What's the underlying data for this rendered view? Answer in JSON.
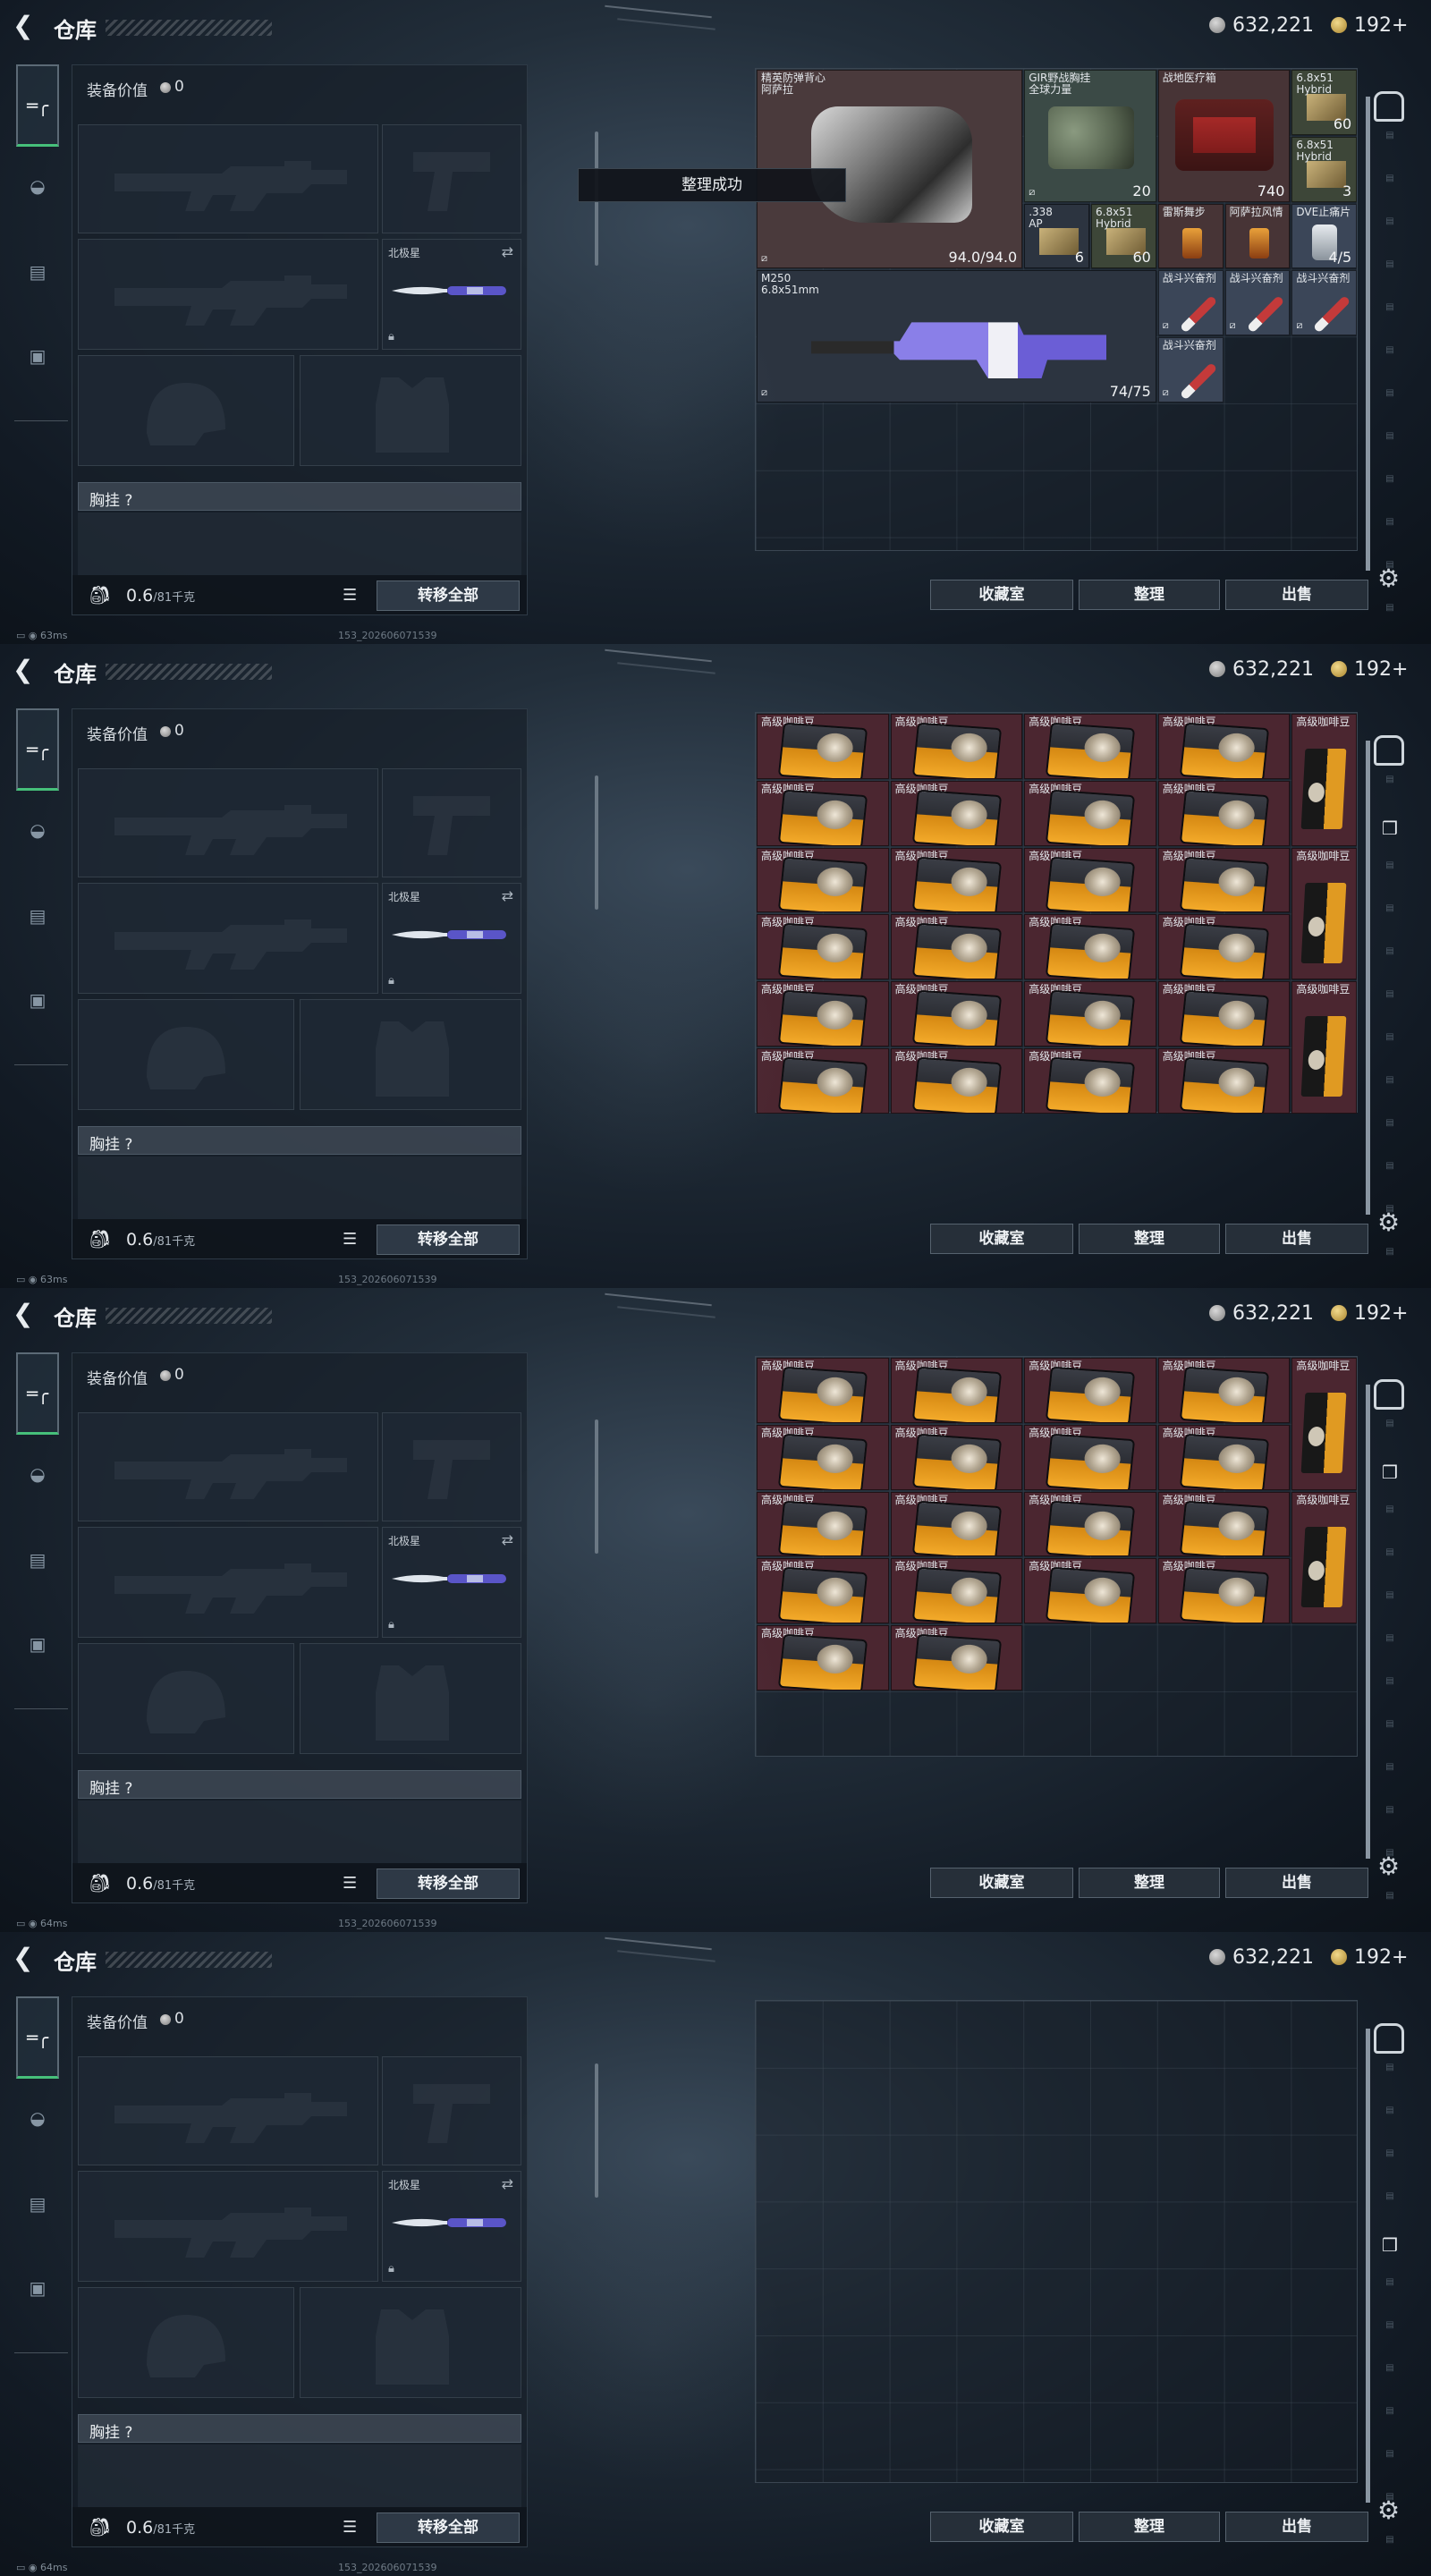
{
  "header": {
    "title": "仓库",
    "silver_amount": "632,221",
    "gold_amount": "192+"
  },
  "sidebar": {
    "items": [
      {
        "icon": "pistol-icon"
      },
      {
        "icon": "helmet-icon"
      },
      {
        "icon": "vest-icon"
      },
      {
        "icon": "briefcase-icon"
      }
    ]
  },
  "equipment": {
    "value_label": "装备价值",
    "value": "0",
    "melee_label": "北极星",
    "chest_label": "胸挂 ?",
    "weight": "0.6",
    "weight_max": "/81千克",
    "transfer_all": "转移全部"
  },
  "buttons": {
    "collection": "收藏室",
    "organize": "整理",
    "sell": "出售"
  },
  "toast": "整理成功",
  "panels": [
    {
      "ping": "63ms",
      "build": "153_202606071539"
    },
    {
      "ping": "63ms",
      "build": "153_202606071539"
    },
    {
      "ping": "64ms",
      "build": "153_202606071539"
    },
    {
      "ping": "64ms",
      "build": "153_202606071539"
    }
  ],
  "stash_items_panel1": [
    {
      "name": "精英防弹背心\n阿萨拉",
      "value": "94.0/94.0"
    },
    {
      "name": "GIR野战胸挂\n全球力量",
      "value": "20"
    },
    {
      "name": "战地医疗箱",
      "value": "740"
    },
    {
      "name": "6.8x51\nHybrid",
      "value": "60"
    },
    {
      "name": "6.8x51\nHybrid",
      "value": "3"
    },
    {
      "name": ".338\nAP",
      "value": "6"
    },
    {
      "name": "6.8x51\nHybrid",
      "value": "60"
    },
    {
      "name": "雷斯舞步",
      "value": ""
    },
    {
      "name": "阿萨拉风情",
      "value": ""
    },
    {
      "name": "DVE止痛片",
      "value": "4/5"
    },
    {
      "name": "M250\n6.8x51mm",
      "value": "74/75"
    },
    {
      "name": "战斗兴奋剂",
      "value": ""
    },
    {
      "name": "战斗兴奋剂",
      "value": ""
    },
    {
      "name": "战斗兴奋剂",
      "value": ""
    },
    {
      "name": "战斗兴奋剂",
      "value": ""
    }
  ],
  "coffee_label": "高级咖啡豆",
  "colors": {
    "accent_green": "#46c07a",
    "coffee_bg": "#4b2630",
    "armor_bg": "#4a3a3c",
    "rig_bg": "#3b4a46",
    "medkit_bg": "#473436",
    "ammo_bg": "#3d4638",
    "weapon_bg": "#2c3440",
    "stim_bg": "#3b4658"
  }
}
